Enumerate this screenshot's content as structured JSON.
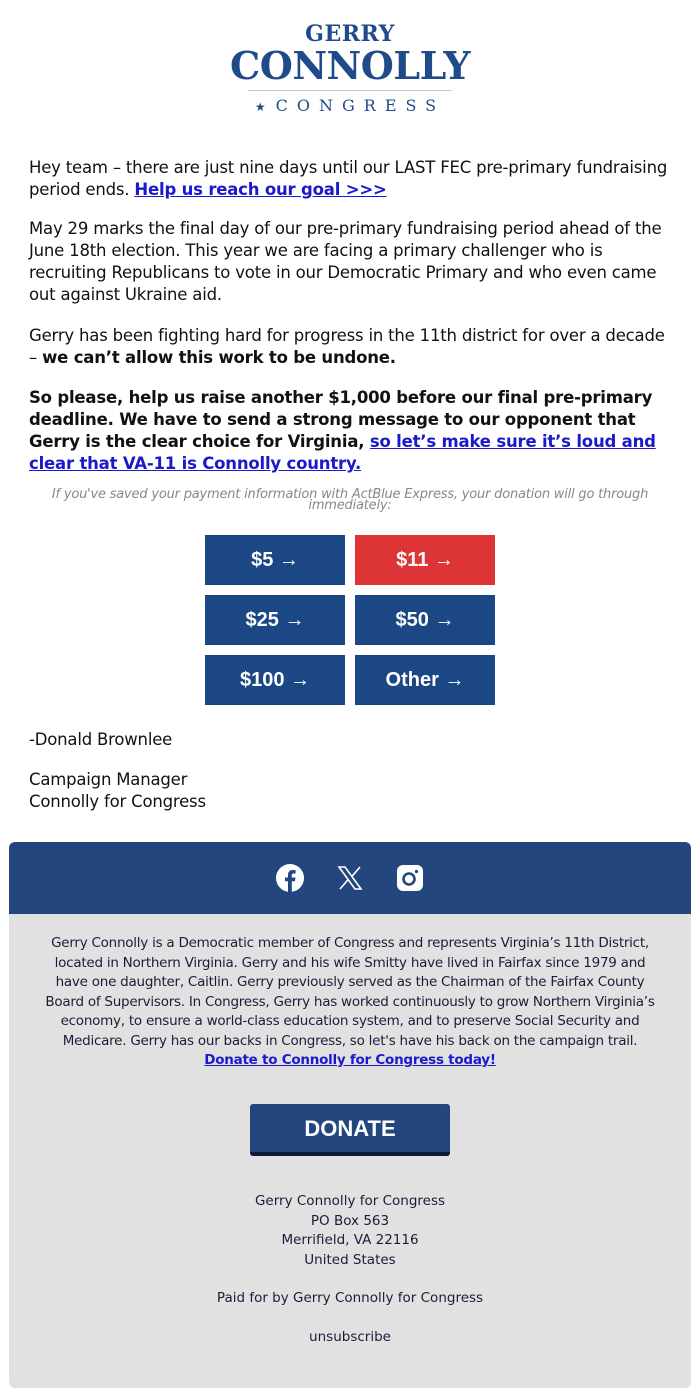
{
  "logo": {
    "line1": "GERRY",
    "line2": "CONNOLLY",
    "line3": "CONGRESS",
    "star": "★",
    "brand_color": "#1f4b8a"
  },
  "message": {
    "p1_text": "Hey team – there are just nine days until our LAST FEC pre-primary fundraising period ends. ",
    "p1_link": "Help us reach our goal >>>",
    "p2_text": "May 29 marks the final day of our pre-primary fundraising period ahead of the June 18th election. This year we are facing a primary challenger who is recruiting Republicans to vote in our Democratic Primary and who even came out against Ukraine aid.",
    "p3_text": "Gerry has been fighting hard for progress in the 11th district for over a decade – ",
    "p3_bold": "we can’t allow this work to be undone.",
    "p4_text": "So please, help us raise another $1,000 before our final pre-primary deadline. We have to send a strong message to our opponent that Gerry is the clear choice for Virginia, ",
    "p4_link": "so let’s make sure it’s loud and clear that VA-11 is Connolly country.",
    "express_note": "If you've saved your payment information with ActBlue Express, your donation will go through immediately:"
  },
  "donation_buttons": [
    {
      "label": "$5 →",
      "color": "#1b4884"
    },
    {
      "label": "$11 →",
      "color": "#dd3535"
    },
    {
      "label": "$25 →",
      "color": "#1b4884"
    },
    {
      "label": "$50 →",
      "color": "#1b4884"
    },
    {
      "label": "$100 →",
      "color": "#1b4884"
    },
    {
      "label": "Other →",
      "color": "#1b4884"
    }
  ],
  "signature": {
    "name": "-Donald Brownlee",
    "title": "Campaign Manager",
    "org": "Connolly for Congress"
  },
  "footer": {
    "social_icons": [
      "facebook-icon",
      "x-twitter-icon",
      "instagram-icon"
    ],
    "bio_text": "Gerry Connolly is a Democratic member of Congress and represents Virginia’s 11th District, located in Northern Virginia. Gerry and his wife Smitty have lived in Fairfax since 1979 and have one daughter, Caitlin. Gerry previously served as the Chairman of the Fairfax County Board of Supervisors. In Congress, Gerry has worked continuously to grow Northern Virginia’s economy, to ensure a world-class education system, and to preserve Social Security and Medicare. Gerry has our backs in Congress, so let's have his back on the campaign trail. ",
    "bio_link": "Donate to Connolly for Congress today!",
    "donate_label": "DONATE",
    "address": [
      "Gerry Connolly for Congress",
      "PO Box 563",
      "Merrifield, VA 22116",
      "United States"
    ],
    "paid_for": "Paid for by Gerry Connolly for Congress",
    "unsubscribe": "unsubscribe",
    "header_color": "#24467f",
    "background_color": "#e1e1e1"
  }
}
